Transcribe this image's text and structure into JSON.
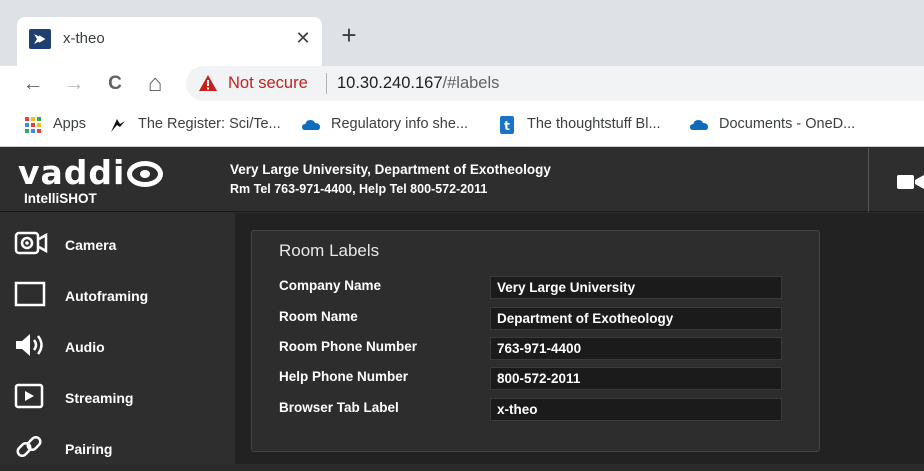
{
  "browser": {
    "tab": {
      "title": "x-theo",
      "close": "✕"
    },
    "new_tab": "+",
    "toolbar": {
      "back": "←",
      "forward": "→",
      "reload": "C",
      "home": "⌂",
      "security_label": "Not secure",
      "url_host": "10.30.240.167",
      "url_path": "/#labels"
    },
    "bookmarks": [
      {
        "label": "Apps",
        "icon": "apps-grid-icon"
      },
      {
        "label": "The Register: Sci/Te...",
        "icon": "register-icon"
      },
      {
        "label": "Regulatory info she...",
        "icon": "onedrive-cloud-icon"
      },
      {
        "label": "The thoughtstuff Bl...",
        "icon": "thoughtstuff-icon"
      },
      {
        "label": "Documents - OneD...",
        "icon": "onedrive-cloud-icon"
      }
    ],
    "colors": {
      "tabbar": "#dee1e6",
      "omnibox": "#f1f3f4",
      "insecure": "#c5221f"
    }
  },
  "app": {
    "logo": "vaddi",
    "product": "IntelliSHOT",
    "site_line1": "Very Large University, Department of Exotheology",
    "site_line2": "Rm Tel 763-971-4400, Help Tel 800-572-2011",
    "nav": [
      {
        "label": "Camera",
        "icon": "camera-icon"
      },
      {
        "label": "Autoframing",
        "icon": "autoframing-icon"
      },
      {
        "label": "Audio",
        "icon": "speaker-icon"
      },
      {
        "label": "Streaming",
        "icon": "play-icon"
      },
      {
        "label": "Pairing",
        "icon": "link-icon"
      }
    ],
    "panel": {
      "title": "Room Labels",
      "fields": [
        {
          "label": "Company Name",
          "value": "Very Large University"
        },
        {
          "label": "Room Name",
          "value": "Department of Exotheology"
        },
        {
          "label": "Room Phone Number",
          "value": "763-971-4400"
        },
        {
          "label": "Help Phone Number",
          "value": "800-572-2011"
        },
        {
          "label": "Browser Tab Label",
          "value": "x-theo"
        }
      ]
    },
    "colors": {
      "header": "#2e2e2e",
      "main_bg": "#222222",
      "panel_bg": "#2d2d2d",
      "field_bg": "#1b1b1b"
    }
  }
}
